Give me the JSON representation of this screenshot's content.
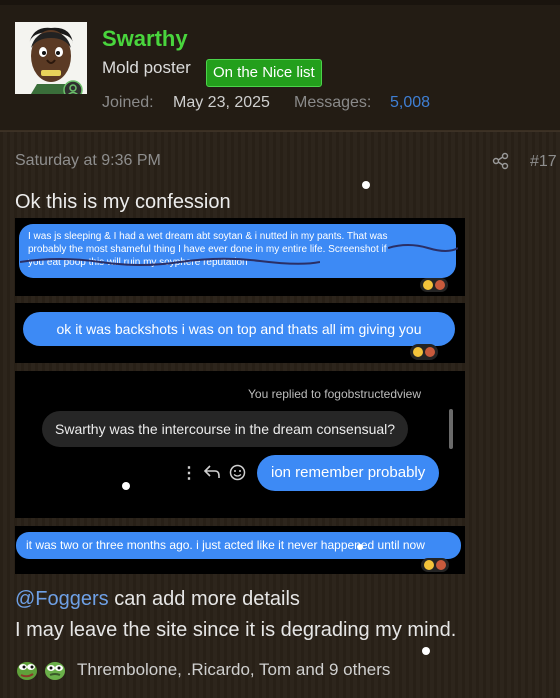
{
  "user": {
    "name": "Swarthy",
    "title": "Mold poster",
    "badge": "On the Nice list",
    "joined_label": "Joined:",
    "joined_value": "May 23, 2025",
    "messages_label": "Messages:",
    "messages_value": "5,008"
  },
  "post": {
    "timestamp": "Saturday at 9:36 PM",
    "number": "#17",
    "intro": "Ok this is my confession",
    "screenshots": {
      "msg1_line1": "I was js sleeping & I had a wet dream abt soytan & i nutted in my pants. That was",
      "msg1_line2": "probably the most shameful thing I have ever done in my entire life. Screenshot if",
      "msg1_line3": "you eat poop this will ruin my soyphere reputation",
      "msg2": "ok it was backshots i was on top and thats all im giving you",
      "reply_header": "You replied to fogobstructedview",
      "question": "Swarthy was the intercourse in the dream consensual?",
      "answer": "ion remember probably",
      "msg4": "it was two or three months ago. i just acted like it never happened until now"
    },
    "mention": "@Foggers",
    "mention_rest": " can add more details",
    "leave_text": "I may leave the site since it is degrading my mind.",
    "reactions_text": "Thrembolone, .Ricardo, Tom and 9 others"
  },
  "colors": {
    "username": "#49d53d",
    "badge_bg": "#239f1c",
    "link": "#3f7fd4",
    "bubble_blue": "#3d8af5",
    "background": "#2a2218"
  },
  "icons": [
    "share-icon",
    "more-icon",
    "reply-icon",
    "emoji-icon",
    "online-icon"
  ]
}
